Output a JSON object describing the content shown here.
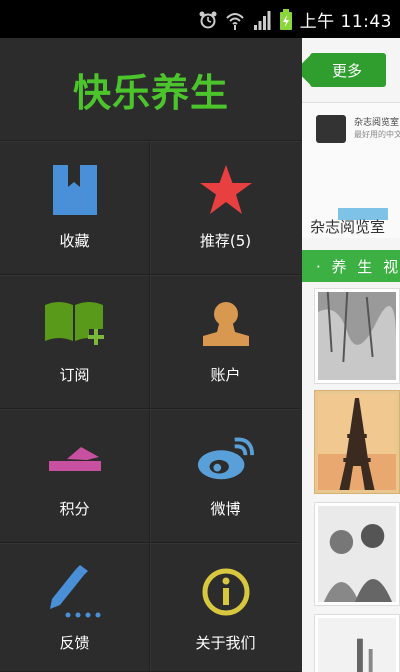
{
  "status_bar": {
    "time": "上午 11:43",
    "icons": [
      "alarm-icon",
      "wifi-icon",
      "signal-icon",
      "battery-icon"
    ]
  },
  "drawer": {
    "app_title": "快乐养生",
    "menu": [
      {
        "label": "收藏",
        "icon": "bookmark-icon",
        "color": "#4a90d9"
      },
      {
        "label": "推荐(5)",
        "icon": "star-icon",
        "color": "#e84040"
      },
      {
        "label": "订阅",
        "icon": "book-add-icon",
        "color": "#5a9a1a"
      },
      {
        "label": "账户",
        "icon": "user-icon",
        "color": "#d89850"
      },
      {
        "label": "积分",
        "icon": "points-icon",
        "color": "#c850a0"
      },
      {
        "label": "微博",
        "icon": "weibo-icon",
        "color": "#5aa0d8"
      },
      {
        "label": "反馈",
        "icon": "pencil-icon",
        "color": "#4a90d9"
      },
      {
        "label": "关于我们",
        "icon": "info-icon",
        "color": "#d8c840"
      }
    ]
  },
  "content": {
    "more_button": "更多",
    "ad": {
      "line1": "杂志阅览室",
      "line2": "最好用的中文",
      "caption": "杂志阅览室"
    },
    "section_title": "· 养 生 视"
  },
  "colors": {
    "accent_green": "#4cc42c",
    "drawer_bg": "#2c2c2c"
  }
}
